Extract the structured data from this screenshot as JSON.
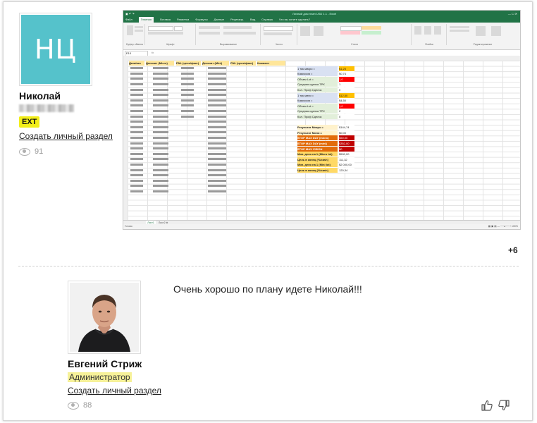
{
  "post1": {
    "avatar_initials": "НЦ",
    "avatar_color": "#55c2cb",
    "username": "Николай",
    "badge": "EXT",
    "create_section_link": "Создать личный раздел",
    "views": "91",
    "more_attachments": "+6",
    "attachment": {
      "icon": "excel-screenshot",
      "headers": [
        "Дата/вес",
        "Депозит (Micro)",
        "PNL (цель/факт)",
        "Депозит (Mini)",
        "PNL (цель/факт)",
        "Коммент"
      ],
      "right_labels": [
        "1 тик микро =",
        "Комиссия =",
        "Объем Lot =",
        "Средняя сделка TPK",
        "Кол. Проф Сделок",
        "1 тик мини =",
        "Комиссия =",
        "Объем Lot =",
        "Средняя сделка TPK",
        "Кол. Проф Сделок",
        "Результат Микро =",
        "Результат Мини =",
        "STOP MAX DAY (micro)",
        "STOP MAX DAY (mini)",
        "STOP MAX VISION",
        "Мин. депо на 1 (Micro lot)",
        "Цель в конец (%/cash)",
        "Мин. депо на 1 (Mini lot)",
        "Цель в конец (%/cash)"
      ],
      "right_values": [
        "$1,25",
        "$0,74",
        "1,0",
        "1",
        "0",
        "$12,50",
        "$4,50",
        "1,0",
        "2",
        "0",
        "$144,74",
        "$0,00",
        "$50,00",
        "$352,00",
        "$0",
        "$500,00",
        "111,32",
        "$2 000,00",
        "120,34"
      ]
    }
  },
  "post2": {
    "avatar_icon": "user-photo",
    "username": "Евгений Стриж",
    "role": "Администратор",
    "create_section_link": "Создать личный раздел",
    "views": "88",
    "message": "Очень хорошо по плану идете Николай!!!"
  }
}
